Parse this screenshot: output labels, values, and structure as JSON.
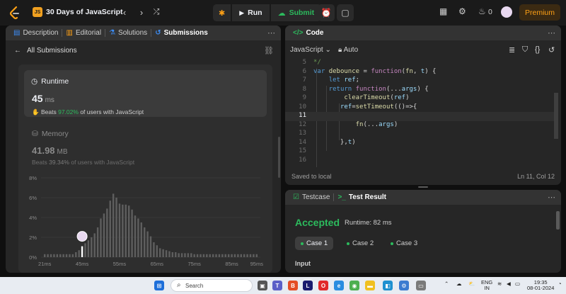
{
  "topbar": {
    "list_title": "30 Days of JavaScript",
    "badge": "JS",
    "run_label": "Run",
    "submit_label": "Submit",
    "streak": "0",
    "premium_label": "Premium"
  },
  "left": {
    "tabs": [
      "Description",
      "Editorial",
      "Solutions",
      "Submissions"
    ],
    "back_label": "All Submissions",
    "runtime": {
      "title": "Runtime",
      "value": "45",
      "unit": "ms",
      "beats_prefix": "Beats",
      "beats_pct": "97.02%",
      "beats_suffix": "of users with JavaScript"
    },
    "memory": {
      "title": "Memory",
      "value": "41.98",
      "unit": "MB",
      "beats_prefix": "Beats",
      "beats_pct": "39.34%",
      "beats_suffix": "of users with JavaScript"
    }
  },
  "chart_data": {
    "type": "bar",
    "ylim": [
      0,
      8
    ],
    "yticks": [
      "0%",
      "2%",
      "4%",
      "6%",
      "8%"
    ],
    "xticks": [
      "21ms",
      "45ms",
      "55ms",
      "65ms",
      "75ms",
      "85ms",
      "95ms"
    ],
    "grid": true,
    "values": [
      0.3,
      0.3,
      0.3,
      0.3,
      0.3,
      0.3,
      0.3,
      0.3,
      0.3,
      0.3,
      0.5,
      0.7,
      1.1,
      1.4,
      1.7,
      2.0,
      2.4,
      3.0,
      3.9,
      4.4,
      4.9,
      5.7,
      6.4,
      6.0,
      5.4,
      5.3,
      5.3,
      5.2,
      4.8,
      4.2,
      3.9,
      3.5,
      3.0,
      2.6,
      2.1,
      1.5,
      1.2,
      0.9,
      0.8,
      0.7,
      0.6,
      0.5,
      0.5,
      0.4,
      0.4,
      0.4,
      0.4,
      0.4,
      0.3,
      0.3,
      0.3,
      0.3,
      0.3,
      0.3,
      0.3,
      0.3,
      0.3,
      0.3,
      0.3,
      0.3,
      0.3,
      0.3,
      0.3,
      0.3,
      0.3,
      0.3,
      0.3,
      0.3,
      0.3
    ],
    "highlight_index": 12
  },
  "editor": {
    "title": "Code",
    "language": "JavaScript",
    "mode": "Auto",
    "status_left": "Saved to local",
    "cursor": "Ln 11, Col 12",
    "lines": [
      {
        "n": "5",
        "text": "*/"
      },
      {
        "n": "6",
        "text": "var debounce = function(fn, t) {"
      },
      {
        "n": "7",
        "text": "    let ref;"
      },
      {
        "n": "8",
        "text": "    return function(...args) {"
      },
      {
        "n": "9",
        "text": "        clearTimeout(ref)"
      },
      {
        "n": "10",
        "text": "       ref=setTimeout(()=>{"
      },
      {
        "n": "11",
        "text": ""
      },
      {
        "n": "12",
        "text": "           fn(...args)"
      },
      {
        "n": "13",
        "text": ""
      },
      {
        "n": "14",
        "text": "       },t)"
      },
      {
        "n": "15",
        "text": ""
      },
      {
        "n": "16",
        "text": ""
      }
    ]
  },
  "result": {
    "tab_testcase": "Testcase",
    "tab_result": "Test Result",
    "status": "Accepted",
    "runtime": "Runtime: 82 ms",
    "cases": [
      "Case 1",
      "Case 2",
      "Case 3"
    ],
    "input_label": "Input"
  },
  "taskbar": {
    "search_placeholder": "Search",
    "lang_top": "ENG",
    "lang_bottom": "IN",
    "time": "19:35",
    "date": "08-01-2024"
  }
}
